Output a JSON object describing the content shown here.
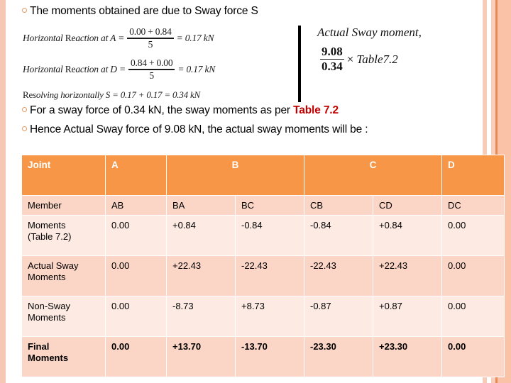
{
  "slide": {
    "bullets": [
      {
        "id": "b1",
        "text": "The moments obtained are due to Sway force S",
        "marker": "circle-bullet-icon"
      },
      {
        "id": "b2",
        "text_before": "For a sway force of 0.34 kN, the sway moments as per ",
        "highlight": "Table 7.2",
        "text_after": "",
        "marker": "circle-bullet-icon"
      },
      {
        "id": "b3",
        "text_before": "Hence Actual Sway force of 9.08 kN, the actual sway moments will be :",
        "highlight": "",
        "text_after": "",
        "marker": "circle-bullet-icon"
      }
    ],
    "equations": {
      "reaction_a": {
        "lead_italic": "Horizontal",
        "lead_upright": "Re",
        "lead_italic2": "action at A",
        "equals": "=",
        "numerator": "0.00 + 0.84",
        "denominator": "5",
        "result": "= 0.17 kN"
      },
      "reaction_d": {
        "lead_italic": "Horizontal",
        "lead_upright": "Re",
        "lead_italic2": "action at D",
        "equals": "=",
        "numerator": "0.84 + 0.00",
        "denominator": "5",
        "result": "= 0.17 kN"
      },
      "resolving": {
        "lead_upright": "Re",
        "lead_italic": "solving horizontally S",
        "rest": "= 0.17 + 0.17 = 0.34 kN"
      },
      "actual_sway": {
        "title": "Actual Sway moment,",
        "numerator": "9.08",
        "denominator": "0.34",
        "times": "×",
        "table_ref": "Table7.2"
      }
    },
    "table": {
      "header": [
        {
          "label": "Joint",
          "span": 1,
          "align": "left"
        },
        {
          "label": "A",
          "span": 1,
          "align": "left"
        },
        {
          "label": "B",
          "span": 2,
          "align": "center"
        },
        {
          "label": "C",
          "span": 2,
          "align": "center"
        },
        {
          "label": "D",
          "span": 1,
          "align": "left"
        }
      ],
      "rows": [
        {
          "label": "Member",
          "values": [
            "AB",
            "BA",
            "BC",
            "CB",
            "CD",
            "DC"
          ],
          "shade": "a",
          "final": false
        },
        {
          "label": "Moments\n(Table 7.2)",
          "label_line1": "Moments",
          "label_line2": "(Table 7.2)",
          "values": [
            "0.00",
            "+0.84",
            "-0.84",
            "-0.84",
            "+0.84",
            "0.00"
          ],
          "shade": "b",
          "final": false
        },
        {
          "label": "Actual Sway Moments",
          "label_line1": "Actual Sway",
          "label_line2": "Moments",
          "values": [
            "0.00",
            "+22.43",
            "-22.43",
            "-22.43",
            "+22.43",
            "0.00"
          ],
          "shade": "a",
          "final": false
        },
        {
          "label": "Non-Sway Moments",
          "label_line1": "Non-Sway",
          "label_line2": "Moments",
          "values": [
            "0.00",
            "-8.73",
            "+8.73",
            "-0.87",
            "+0.87",
            "0.00"
          ],
          "shade": "b",
          "final": false
        },
        {
          "label": "Final Moments",
          "label_line1": "Final",
          "label_line2": "Moments",
          "values": [
            "0.00",
            "+13.70",
            "-13.70",
            "-23.30",
            "+23.30",
            "0.00"
          ],
          "shade": "a",
          "final": true
        }
      ]
    },
    "colors": {
      "header_orange": "#F79646",
      "row_dark": "#FBD5C5",
      "row_light": "#FDEAE2",
      "accent_red": "#C00000",
      "bullet_orange": "#E59A62",
      "frame_pink": "#F6C7B4",
      "stripe_orange": "#EA8A54",
      "stripe_salmon": "#FAC3A8"
    }
  }
}
